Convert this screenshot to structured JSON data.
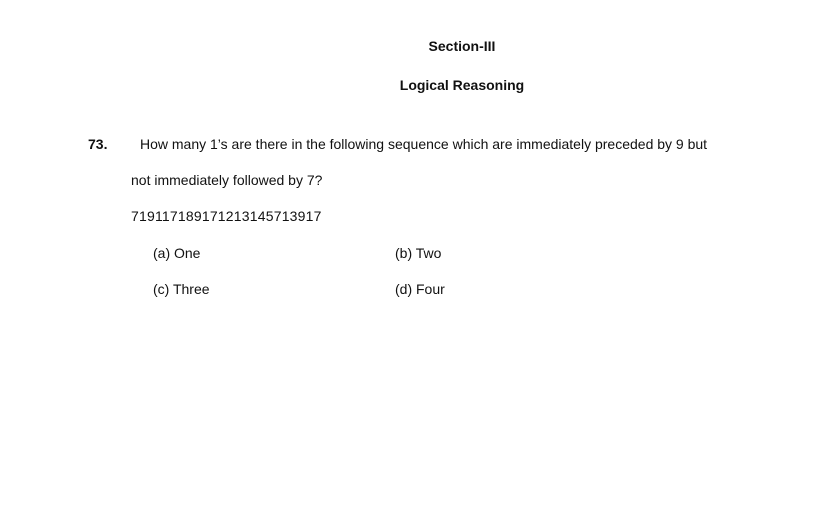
{
  "section": "Section-III",
  "subject": "Logical Reasoning",
  "question": {
    "number": "73.",
    "text_line1": "How many 1’s are there in the following sequence which are immediately preceded by 9 but",
    "text_line2": "not immediately followed by 7?",
    "sequence": "719117189171213145713917",
    "options": [
      {
        "label": "(a) One"
      },
      {
        "label": "(b) Two"
      },
      {
        "label": "(c) Three"
      },
      {
        "label": "(d) Four"
      }
    ]
  }
}
